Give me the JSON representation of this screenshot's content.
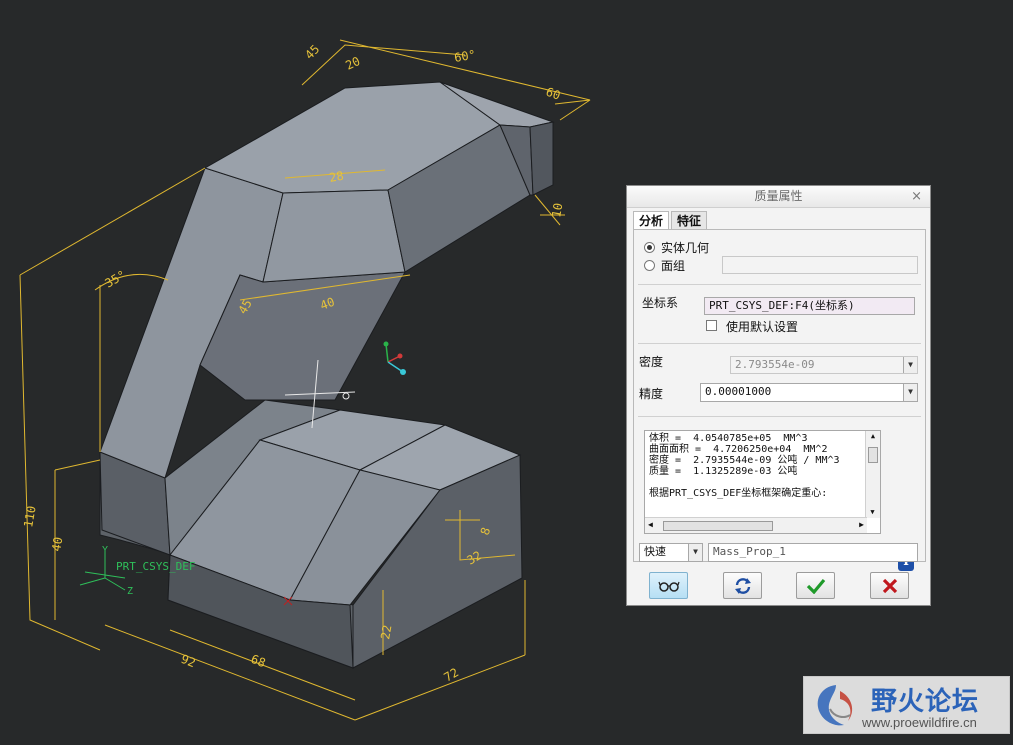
{
  "viewport": {
    "csys_label": "PRT_CSYS_DEF",
    "axis_y": "Y",
    "axis_x": "X",
    "axis_z": "Z",
    "dimensions": {
      "d45": "45",
      "d20": "20",
      "d60a": "60°",
      "d60b": "60",
      "d28": "28",
      "d10": "10",
      "d35": "35°",
      "d40a": "40",
      "d45b": "45",
      "d110": "110",
      "d40b": "40",
      "d92": "92",
      "d68": "68",
      "d72": "72",
      "d22": "22",
      "d8": "8",
      "d32": "32"
    }
  },
  "dialog": {
    "title": "质量属性",
    "close": "×",
    "tabs": [
      "分析",
      "特征"
    ],
    "geometry_solid": "实体几何",
    "geometry_quilt": "面组",
    "csys_label": "坐标系",
    "csys_value": "PRT_CSYS_DEF:F4(坐标系)",
    "use_default": "使用默认设置",
    "density_label": "密度",
    "density_value": "2.793554e-09",
    "accuracy_label": "精度",
    "accuracy_value": "0.00001000",
    "results": [
      "体积 =  4.0540785e+05  MM^3",
      "曲面面积 =  4.7206250e+04  MM^2",
      "密度 =  2.7935544e-09 公吨 / MM^3",
      "质量 =  1.1325289e-03 公吨",
      "",
      "根据PRT_CSYS_DEF坐标框架确定重心:"
    ],
    "mode_value": "快速",
    "name_value": "Mass_Prop_1"
  },
  "watermark": {
    "title": "野火论坛",
    "url": "www.proewildfire.cn"
  },
  "colors": {
    "background": "#27292a",
    "dimension": "#e0b830",
    "ok_green": "#1f9a2a",
    "cancel_red": "#c0181e",
    "info_blue": "#1d4fa8"
  }
}
